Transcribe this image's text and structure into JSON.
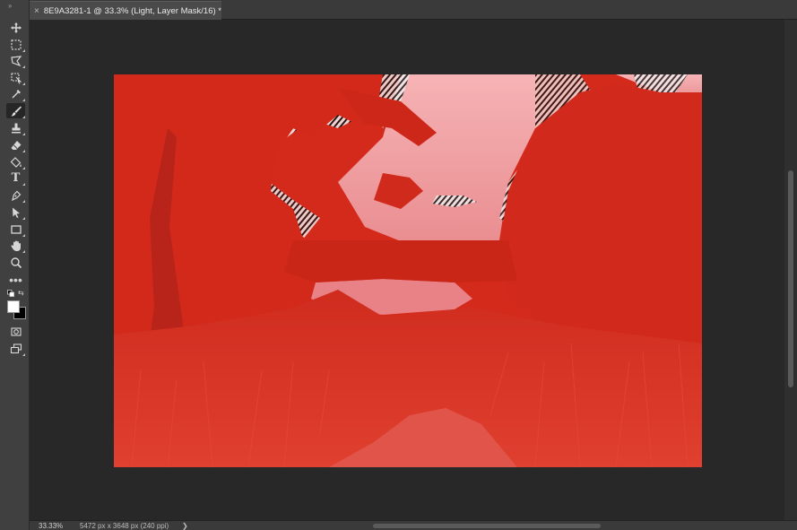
{
  "document": {
    "tab_title": "8E9A3281-1 @ 33.3% (Light, Layer Mask/16) *",
    "close_glyph": "×"
  },
  "toolbar": {
    "grip_glyph": "››",
    "tools": [
      {
        "name": "move-tool",
        "icon": "move-icon"
      },
      {
        "name": "rectangular-marquee-tool",
        "icon": "marquee-icon"
      },
      {
        "name": "lasso-tool",
        "icon": "polygonal-lasso-icon"
      },
      {
        "name": "object-selection-tool",
        "icon": "object-selection-icon"
      },
      {
        "name": "eyedropper-tool",
        "icon": "eyedropper-icon"
      },
      {
        "name": "brush-tool",
        "icon": "brush-icon",
        "active": true
      },
      {
        "name": "clone-stamp-tool",
        "icon": "stamp-icon"
      },
      {
        "name": "eraser-tool",
        "icon": "eraser-icon"
      },
      {
        "name": "paint-bucket-tool",
        "icon": "paint-bucket-icon"
      },
      {
        "name": "type-tool",
        "icon": "type-icon",
        "glyph": "T"
      },
      {
        "name": "pen-tool",
        "icon": "pen-icon"
      },
      {
        "name": "path-selection-tool",
        "icon": "arrow-select-icon"
      },
      {
        "name": "rectangle-tool",
        "icon": "rectangle-icon"
      },
      {
        "name": "hand-tool",
        "icon": "hand-icon"
      },
      {
        "name": "zoom-tool",
        "icon": "zoom-icon"
      },
      {
        "name": "edit-toolbar",
        "icon": "more-icon",
        "glyph": "•••"
      },
      {
        "name": "quick-mask",
        "icon": "quick-mask-icon"
      },
      {
        "name": "screen-mode",
        "icon": "screen-mode-icon"
      }
    ],
    "foreground_color": "#ffffff",
    "background_color": "#000000",
    "swap_glyph": "⇆"
  },
  "status": {
    "zoom": "33.33%",
    "doc_info": "5472 px x 3648 px (240 ppi)",
    "arrow": "❯"
  },
  "colors": {
    "app_background": "#282828",
    "panel": "#404040",
    "mask_overlay": "#d42a1c",
    "sky": "#f3a8ac"
  }
}
